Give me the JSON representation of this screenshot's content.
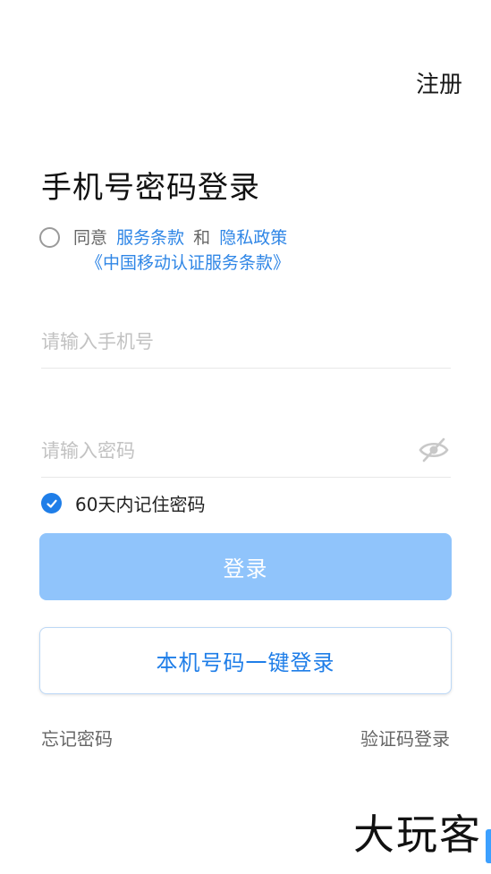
{
  "header": {
    "register_label": "注册"
  },
  "title": "手机号密码登录",
  "agreement": {
    "prefix": "同意",
    "terms_link": "服务条款",
    "and": "和",
    "privacy_link": "隐私政策",
    "cmcc_terms_link": "《中国移动认证服务条款》"
  },
  "form": {
    "phone_placeholder": "请输入手机号",
    "password_placeholder": "请输入密码",
    "remember_label": "60天内记住密码",
    "remember_checked": true
  },
  "buttons": {
    "login_label": "登录",
    "oneclick_label": "本机号码一键登录"
  },
  "links": {
    "forgot_password": "忘记密码",
    "sms_login": "验证码登录"
  },
  "watermark": "大玩客",
  "colors": {
    "accent": "#1f7ee8",
    "link": "#2f86e6",
    "login_button_disabled": "#90c4fb",
    "placeholder": "#c2c2c2"
  },
  "icons": {
    "password_toggle": "eye-off-icon",
    "remember_check": "check-icon",
    "agree_radio": "radio-unchecked-icon"
  }
}
